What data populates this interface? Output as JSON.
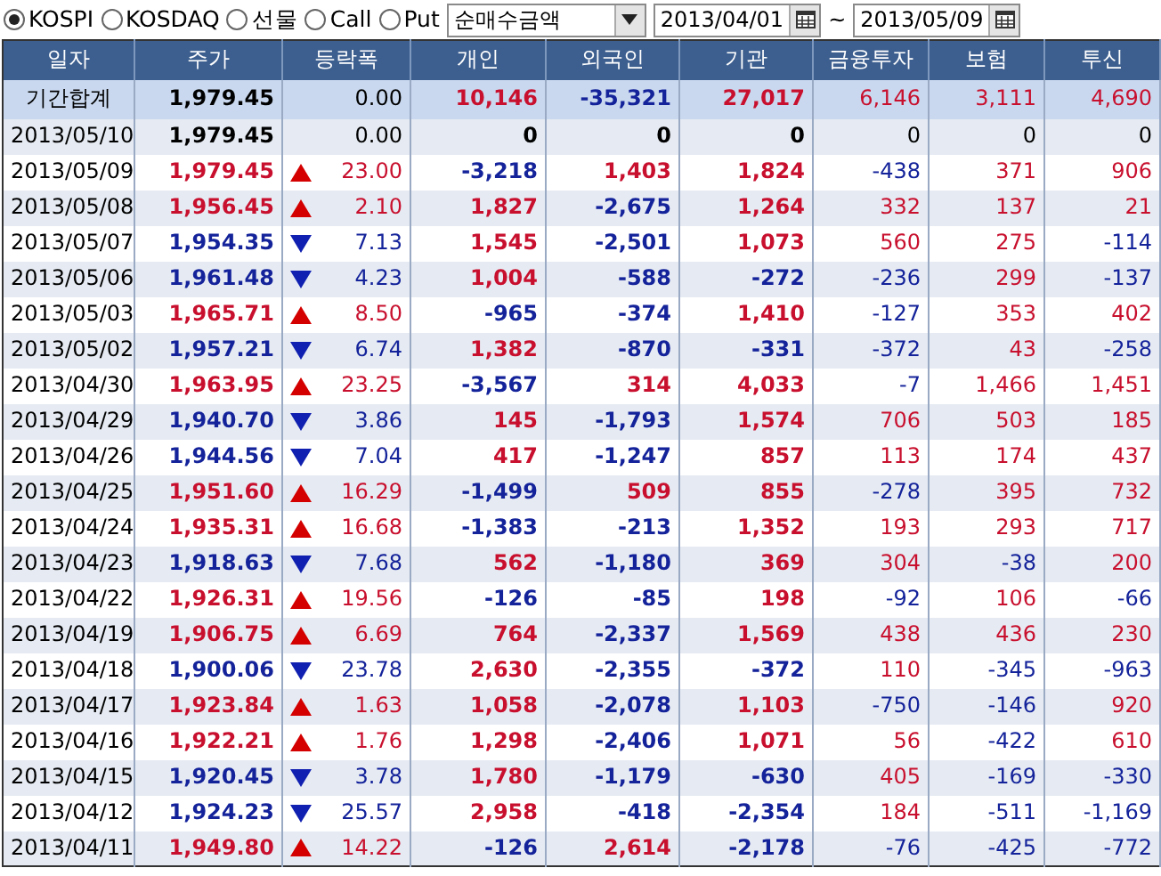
{
  "toolbar": {
    "markets": [
      {
        "label": "KOSPI",
        "selected": true
      },
      {
        "label": "KOSDAQ",
        "selected": false
      },
      {
        "label": "선물",
        "selected": false
      },
      {
        "label": "Call",
        "selected": false
      },
      {
        "label": "Put",
        "selected": false
      }
    ],
    "measure": {
      "value": "순매수금액"
    },
    "start_date": {
      "value": "2013/04/01"
    },
    "range_separator": "~",
    "end_date": {
      "value": "2013/05/09"
    }
  },
  "table": {
    "columns": [
      "일자",
      "주가",
      "등락폭",
      "개인",
      "외국인",
      "기관",
      "금융투자",
      "보험",
      "투신"
    ],
    "summary": {
      "cells": [
        "기간합계",
        "1,979.45",
        "0.00",
        "10,146",
        "-35,321",
        "27,017",
        "6,146",
        "3,111",
        "4,690"
      ]
    },
    "rows": [
      {
        "kind": "flat",
        "cells": [
          "2013/05/10",
          "1,979.45",
          "0.00",
          "0",
          "0",
          "0",
          "0",
          "0",
          "0"
        ]
      },
      {
        "kind": "up",
        "cells": [
          "2013/05/09",
          "1,979.45",
          "23.00",
          "-3,218",
          "1,403",
          "1,824",
          "-438",
          "371",
          "906"
        ]
      },
      {
        "kind": "up",
        "cells": [
          "2013/05/08",
          "1,956.45",
          "2.10",
          "1,827",
          "-2,675",
          "1,264",
          "332",
          "137",
          "21"
        ]
      },
      {
        "kind": "down",
        "cells": [
          "2013/05/07",
          "1,954.35",
          "7.13",
          "1,545",
          "-2,501",
          "1,073",
          "560",
          "275",
          "-114"
        ]
      },
      {
        "kind": "down",
        "cells": [
          "2013/05/06",
          "1,961.48",
          "4.23",
          "1,004",
          "-588",
          "-272",
          "-236",
          "299",
          "-137"
        ]
      },
      {
        "kind": "up",
        "cells": [
          "2013/05/03",
          "1,965.71",
          "8.50",
          "-965",
          "-374",
          "1,410",
          "-127",
          "353",
          "402"
        ]
      },
      {
        "kind": "down",
        "cells": [
          "2013/05/02",
          "1,957.21",
          "6.74",
          "1,382",
          "-870",
          "-331",
          "-372",
          "43",
          "-258"
        ]
      },
      {
        "kind": "up",
        "cells": [
          "2013/04/30",
          "1,963.95",
          "23.25",
          "-3,567",
          "314",
          "4,033",
          "-7",
          "1,466",
          "1,451"
        ]
      },
      {
        "kind": "down",
        "cells": [
          "2013/04/29",
          "1,940.70",
          "3.86",
          "145",
          "-1,793",
          "1,574",
          "706",
          "503",
          "185"
        ]
      },
      {
        "kind": "down",
        "cells": [
          "2013/04/26",
          "1,944.56",
          "7.04",
          "417",
          "-1,247",
          "857",
          "113",
          "174",
          "437"
        ]
      },
      {
        "kind": "up",
        "cells": [
          "2013/04/25",
          "1,951.60",
          "16.29",
          "-1,499",
          "509",
          "855",
          "-278",
          "395",
          "732"
        ]
      },
      {
        "kind": "up",
        "cells": [
          "2013/04/24",
          "1,935.31",
          "16.68",
          "-1,383",
          "-213",
          "1,352",
          "193",
          "293",
          "717"
        ]
      },
      {
        "kind": "down",
        "cells": [
          "2013/04/23",
          "1,918.63",
          "7.68",
          "562",
          "-1,180",
          "369",
          "304",
          "-38",
          "200"
        ]
      },
      {
        "kind": "up",
        "cells": [
          "2013/04/22",
          "1,926.31",
          "19.56",
          "-126",
          "-85",
          "198",
          "-92",
          "106",
          "-66"
        ]
      },
      {
        "kind": "up",
        "cells": [
          "2013/04/19",
          "1,906.75",
          "6.69",
          "764",
          "-2,337",
          "1,569",
          "438",
          "436",
          "230"
        ]
      },
      {
        "kind": "down",
        "cells": [
          "2013/04/18",
          "1,900.06",
          "23.78",
          "2,630",
          "-2,355",
          "-372",
          "110",
          "-345",
          "-963"
        ]
      },
      {
        "kind": "up",
        "cells": [
          "2013/04/17",
          "1,923.84",
          "1.63",
          "1,058",
          "-2,078",
          "1,103",
          "-750",
          "-146",
          "920"
        ]
      },
      {
        "kind": "up",
        "cells": [
          "2013/04/16",
          "1,922.21",
          "1.76",
          "1,298",
          "-2,406",
          "1,071",
          "56",
          "-422",
          "610"
        ]
      },
      {
        "kind": "down",
        "cells": [
          "2013/04/15",
          "1,920.45",
          "3.78",
          "1,780",
          "-1,179",
          "-630",
          "405",
          "-169",
          "-330"
        ]
      },
      {
        "kind": "down",
        "cells": [
          "2013/04/12",
          "1,924.23",
          "25.57",
          "2,958",
          "-418",
          "-2,354",
          "184",
          "-511",
          "-1,169"
        ]
      },
      {
        "kind": "up",
        "cells": [
          "2013/04/11",
          "1,949.80",
          "14.22",
          "-126",
          "2,614",
          "-2,178",
          "-76",
          "-425",
          "-772"
        ]
      }
    ]
  }
}
